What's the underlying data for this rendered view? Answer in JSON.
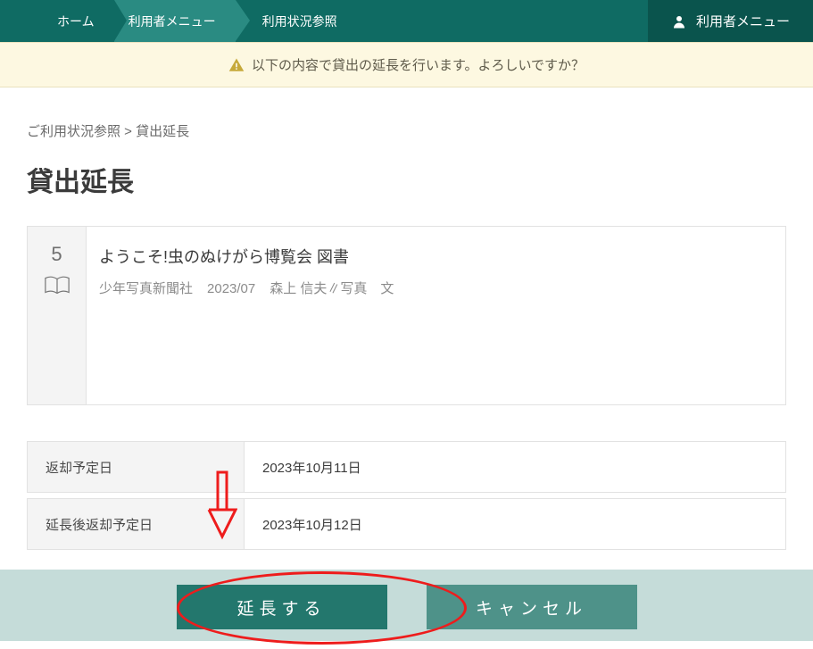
{
  "topbar": {
    "home": "ホーム",
    "menu": "利用者メニュー",
    "status": "利用状況参照",
    "user_menu": "利用者メニュー"
  },
  "warn": {
    "text": "以下の内容で貸出の延長を行います。よろしいですか？"
  },
  "breadcrumb": {
    "parent": "ご利用状況参照",
    "sep": " > ",
    "current": "貸出延長"
  },
  "page_title": "貸出延長",
  "item": {
    "index": "5",
    "title": "ようこそ!虫のぬけがら博覧会 図書",
    "publisher": "少年写真新聞社",
    "date": "2023/07",
    "author": "森上 信夫∥写真　文"
  },
  "dates": {
    "return_label": "返却予定日",
    "return_value": "2023年10月11日",
    "extended_label": "延長後返却予定日",
    "extended_value": "2023年10月12日"
  },
  "actions": {
    "extend": "延長する",
    "cancel": "キャンセル"
  }
}
